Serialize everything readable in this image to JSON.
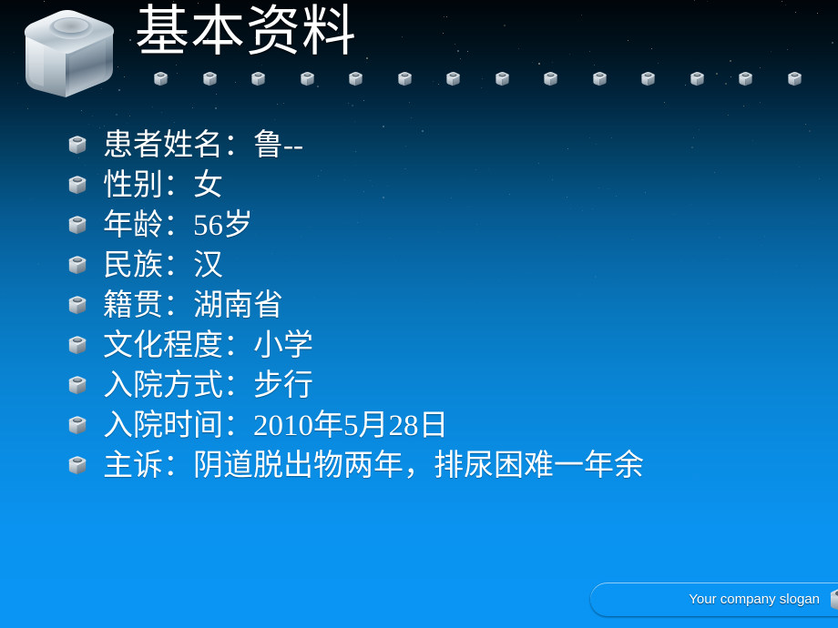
{
  "slide": {
    "title": "基本资料",
    "logo_icon": "metallic-cube-logo",
    "background_colors": {
      "top": "#000509",
      "middle": "#0769a9",
      "bottom": "#0a95f5"
    },
    "header_decoration": {
      "icon": "mini-cube-icon",
      "count": 14
    }
  },
  "bullets": [
    {
      "icon": "cube-bullet-icon",
      "text": "患者姓名：鲁--"
    },
    {
      "icon": "cube-bullet-icon",
      "text": "性别：女"
    },
    {
      "icon": "cube-bullet-icon",
      "text": "年龄：56岁"
    },
    {
      "icon": "cube-bullet-icon",
      "text": "民族：汉"
    },
    {
      "icon": "cube-bullet-icon",
      "text": "籍贯：湖南省"
    },
    {
      "icon": "cube-bullet-icon",
      "text": "文化程度：小学"
    },
    {
      "icon": "cube-bullet-icon",
      "text": "入院方式：步行"
    },
    {
      "icon": "cube-bullet-icon",
      "text": "入院时间：2010年5月28日"
    },
    {
      "icon": "cube-bullet-icon",
      "text": "主诉：阴道脱出物两年，排尿困难一年余"
    }
  ],
  "footer": {
    "slogan": "Your company slogan",
    "icon": "cube-icon"
  }
}
